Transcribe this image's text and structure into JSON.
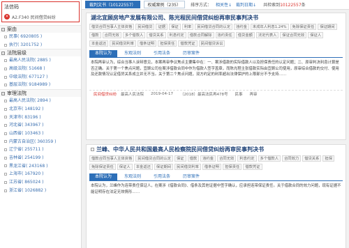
{
  "sidebar": {
    "facet_title": "法信码",
    "facet_chip": "A2.F340 民间借贷纠纷",
    "sections": [
      {
        "title": "案由",
        "items": [
          {
            "label": "民事",
            "count": "( 6920805 )"
          },
          {
            "label": "执行",
            "count": "( 3201752 )"
          }
        ]
      },
      {
        "title": "法院层级",
        "items": [
          {
            "label": "最高人民法院",
            "count": "( 2885 )"
          },
          {
            "label": "高级法院",
            "count": "( 51668 )"
          },
          {
            "label": "中级法院",
            "count": "( 677127 )"
          },
          {
            "label": "基层法院",
            "count": "( 9184989 )"
          }
        ]
      },
      {
        "title": "审理法院",
        "items": [
          {
            "label": "最高人民法院",
            "count": "( 2894 )"
          },
          {
            "label": "北京市",
            "count": "( 148192 )"
          },
          {
            "label": "天津市",
            "count": "( 83196 )"
          },
          {
            "label": "河北省",
            "count": "( 343967 )"
          },
          {
            "label": "山西省",
            "count": "( 103463 )"
          },
          {
            "label": "内蒙古自治区",
            "count": "( 360359 )"
          },
          {
            "label": "辽宁省",
            "count": "( 255711 )"
          },
          {
            "label": "吉林省",
            "count": "( 254199 )"
          },
          {
            "label": "黑龙江省",
            "count": "( 243168 )"
          },
          {
            "label": "上海市",
            "count": "( 167920 )"
          },
          {
            "label": "江苏省",
            "count": "( 865024 )"
          },
          {
            "label": "浙江省",
            "count": "( 1026882 )"
          }
        ]
      }
    ]
  },
  "topbar": {
    "tab_docs": "裁判文书（10122557）",
    "tab_auth": "权威案例（235）",
    "sort_label": "排序方式：",
    "sort_relevance": "相关性↓",
    "sort_date": "裁判日期↓",
    "result_prefix": "共检索到",
    "result_count": "10122557",
    "result_suffix": "条"
  },
  "cards": [
    {
      "title": "湖北宜顾房地产发展有限公司、陈光程民间借贷纠纷再审民事判决书",
      "tags": [
        "借贷合同当事人主体资格",
        "民间借贷",
        "证据",
        "保证",
        "利率",
        "民间借贷合同的认定",
        "违约金",
        "未成年人利息1.24%",
        "免除保证责任",
        "保证期间",
        "借款",
        "合同无效",
        "多个借款人",
        "借贷关系",
        "利息约定",
        "借款合同解除",
        "违约责任",
        "借贷金额",
        "法定代表人",
        "保证合同无效",
        "保证人",
        "本金返还",
        "民间借贷利率",
        "借条证明",
        "担保责任",
        "借款凭证",
        "民间借贷诉讼"
      ],
      "tabs": [
        "本院认为",
        "东观法则",
        "引用法条",
        "历审案件"
      ],
      "abstract": "本院再审认为，综合当事人诉辩意见，本案再审争议焦点主要集中在：一、案涉借款的实际借款人以及担保责任的认定问题；二、原审判决利息计算是否正确。关于第一个焦点问题，宜顾公司在案涉借款合同中作为借款人签字盖章，而陈光程主张借款实际由宜顾公司使用，原审综合借款的交付、使用及还款情况认定借贷关系成立并无不当。关于第二个焦点问题，双方约定的利率超出法律保护的上限部分不予支持……",
      "court": "最高人民法院",
      "date": "2019-04-17",
      "case_no": "（2018）最高法民再478号",
      "doc_type": "民事",
      "stage": "再审",
      "label": "民间借贷纠纷"
    },
    {
      "title": "兰峰、中华人民共和国最高人民检察院民间借贷纠纷再审民事判决书",
      "tags": [
        "借款合同当事人主体资格",
        "民间借贷合同的认定",
        "保证",
        "借款",
        "违约金",
        "合同无效",
        "利息约定",
        "多个借款人",
        "合同效力",
        "借贷关系",
        "担保",
        "免除保证责任",
        "保证人",
        "本金返还",
        "保证期间",
        "民间借贷利率",
        "借条证明",
        "担保责任",
        "借款凭证"
      ],
      "tabs": [
        "本院认为",
        "东观法则",
        "引用法条",
        "历审案件"
      ],
      "abstract": "本院认为，兰峰作为连带责任保证人，在案涉《借款合同》、借条及其他证据中签字确认，应承担连带保证责任。关于借款合同的效力问题，现有证据不能证明存在法定无效情形……"
    }
  ]
}
